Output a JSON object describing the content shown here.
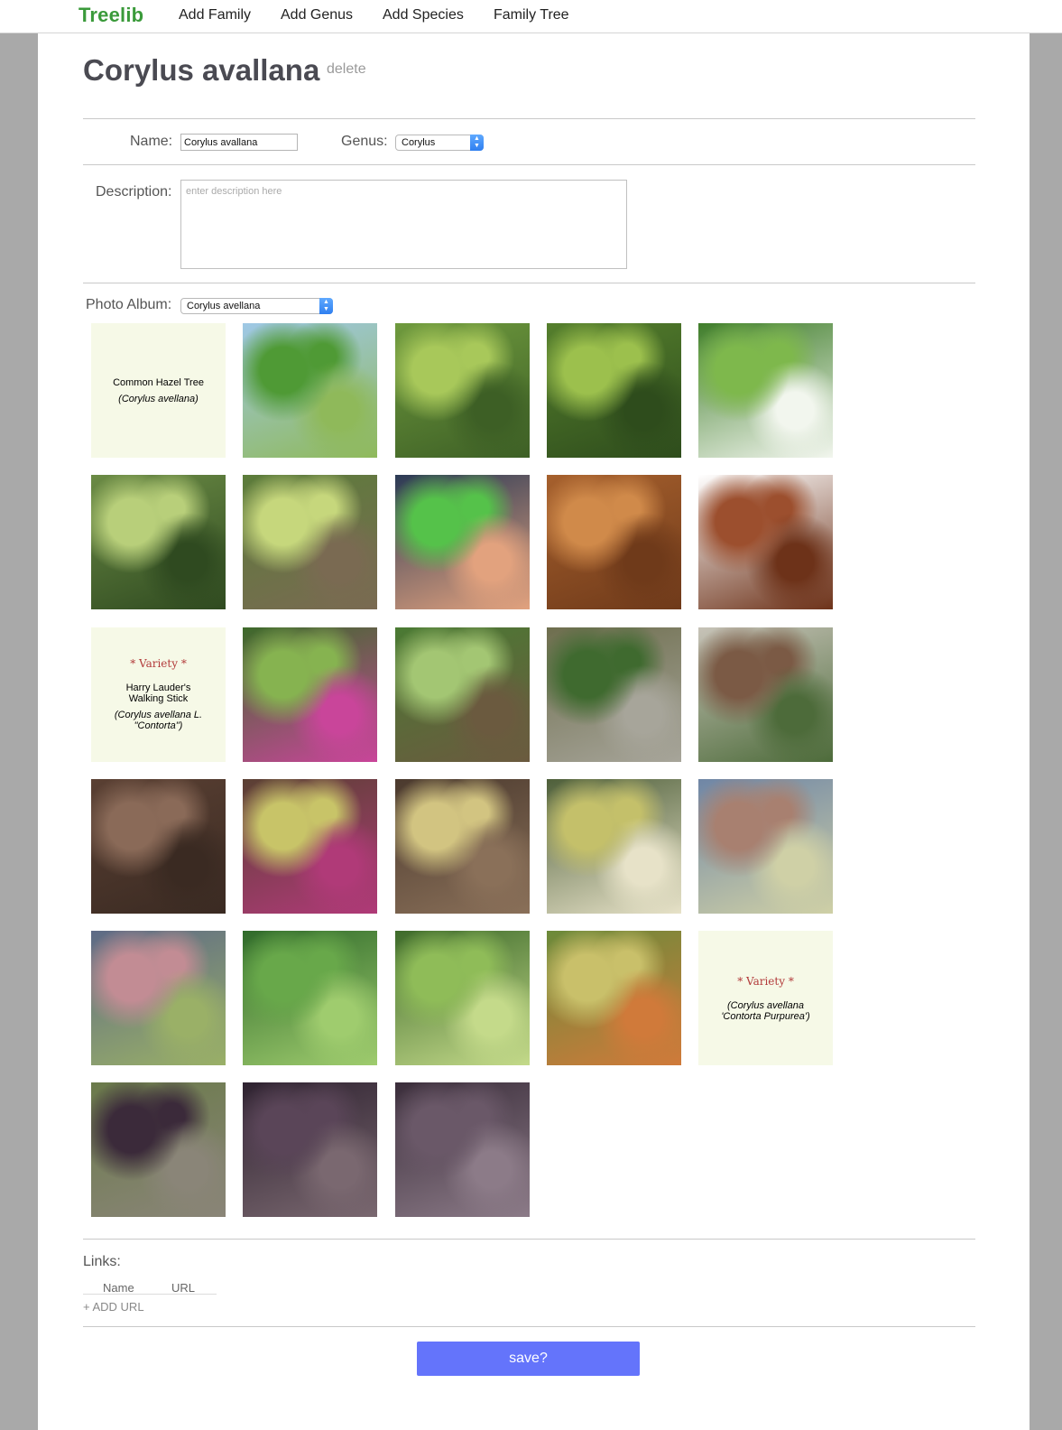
{
  "nav": {
    "brand": "Treelib",
    "links": [
      "Add Family",
      "Add Genus",
      "Add Species",
      "Family Tree"
    ]
  },
  "species": {
    "title": "Corylus avallana",
    "delete_label": "delete"
  },
  "form": {
    "name_label": "Name:",
    "name_value": "Corylus avallana",
    "genus_label": "Genus:",
    "genus_value": "Corylus",
    "description_label": "Description:",
    "description_placeholder": "enter description here",
    "album_label": "Photo Album:",
    "album_value": "Corylus avellana"
  },
  "album": {
    "photos": [
      {
        "kind": "card",
        "lines": [
          "Common Hazel Tree"
        ],
        "italic": [
          "(Corylus avellana)"
        ]
      },
      {
        "kind": "photo",
        "subject": "hazel-tree-garden"
      },
      {
        "kind": "photo",
        "subject": "hazel-orchard-row"
      },
      {
        "kind": "photo",
        "subject": "hazel-orchard-trees"
      },
      {
        "kind": "photo",
        "subject": "hazel-leaves-shrub"
      },
      {
        "kind": "photo",
        "subject": "hazelnut-husks-cluster"
      },
      {
        "kind": "photo",
        "subject": "hazelnut-husks-branch"
      },
      {
        "kind": "photo",
        "subject": "hazelnut-husk-in-hand"
      },
      {
        "kind": "photo",
        "subject": "hazelnuts-pile"
      },
      {
        "kind": "photo",
        "subject": "shelled-hazelnuts"
      },
      {
        "kind": "card",
        "variety": "* Variety *",
        "lines": [
          "Harry Lauder's",
          "Walking Stick"
        ],
        "italic": [
          "(Corylus avellana L.",
          "\"Contorta\")"
        ]
      },
      {
        "kind": "photo",
        "subject": "contorta-tree-lawn"
      },
      {
        "kind": "photo",
        "subject": "contorta-shrub-path"
      },
      {
        "kind": "photo",
        "subject": "contorta-weeping-hedge"
      },
      {
        "kind": "photo",
        "subject": "contorta-bare-house"
      },
      {
        "kind": "photo",
        "subject": "contorta-twisted-branches"
      },
      {
        "kind": "photo",
        "subject": "contorta-catkins-flowers"
      },
      {
        "kind": "photo",
        "subject": "contorta-catkins-branches"
      },
      {
        "kind": "photo",
        "subject": "catkins-closeup"
      },
      {
        "kind": "photo",
        "subject": "catkins-red-flowers"
      },
      {
        "kind": "photo",
        "subject": "catkins-macro"
      },
      {
        "kind": "photo",
        "subject": "contorta-leaves-green"
      },
      {
        "kind": "photo",
        "subject": "contorta-curly-leaves"
      },
      {
        "kind": "photo",
        "subject": "contorta-leaves-sun"
      },
      {
        "kind": "card",
        "variety": "* Variety *",
        "lines": [],
        "italic": [
          "(Corylus avellana",
          "'Contorta Purpurea')"
        ]
      },
      {
        "kind": "photo",
        "subject": "purple-hazel-garden"
      },
      {
        "kind": "photo",
        "subject": "purple-hazel-leaves"
      },
      {
        "kind": "photo",
        "subject": "purple-hazel-closeup"
      }
    ]
  },
  "links": {
    "label": "Links:",
    "col_name": "Name",
    "col_url": "URL",
    "add_label": "+ ADD URL"
  },
  "save_label": "save?",
  "colors": {
    "brand": "#3a9a3a",
    "save_button": "#6474fb",
    "page_background": "#a9a9a9"
  }
}
